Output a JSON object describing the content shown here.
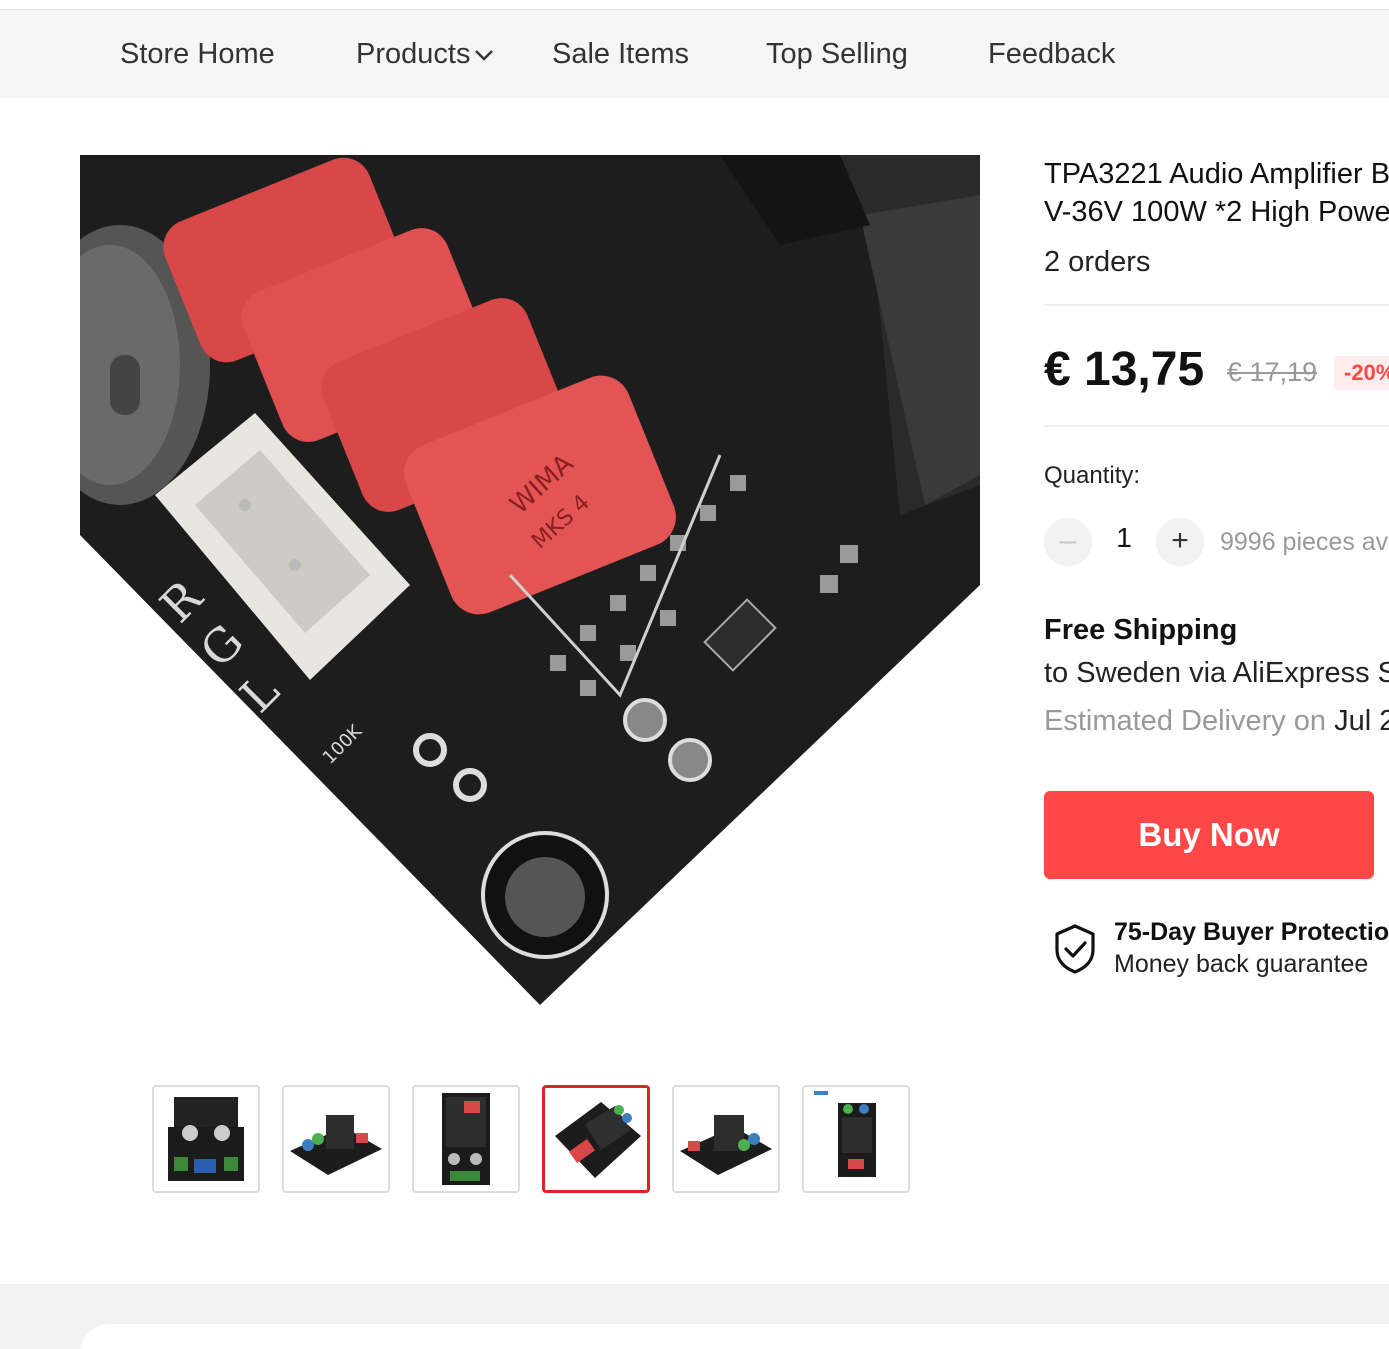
{
  "nav": {
    "items": [
      "Store Home",
      "Products",
      "Sale Items",
      "Top Selling",
      "Feedback"
    ]
  },
  "product": {
    "title_line1": "TPA3221 Audio Amplifier B",
    "title_line2": "V-36V 100W *2 High Power",
    "orders": "2 orders",
    "price": "€ 13,75",
    "original_price": "€ 17,19",
    "discount": "-20%",
    "quantity_label": "Quantity:",
    "quantity": "1",
    "available": "9996 pieces ava",
    "shipping_title": "Free Shipping",
    "shipping_to": "to Sweden via AliExpress S",
    "delivery_label": "Estimated Delivery on",
    "delivery_date": "Jul 2",
    "buy_label": "Buy Now",
    "protection_title": "75-Day Buyer Protectio",
    "protection_sub": "Money back guarantee"
  },
  "gallery": {
    "main_image": "amplifier-board-closeup",
    "thumbnails": [
      "thumb-1",
      "thumb-2",
      "thumb-3",
      "thumb-4",
      "thumb-5",
      "thumb-6"
    ],
    "selected_index": 3
  },
  "colors": {
    "accent": "#ff4747",
    "nav_bg": "#f6f6f6",
    "selected_border": "#e02323"
  },
  "icons": {
    "products_dropdown": "chevron-down-icon",
    "protection": "shield-check-icon",
    "minus": "minus-icon",
    "plus": "plus-icon"
  }
}
